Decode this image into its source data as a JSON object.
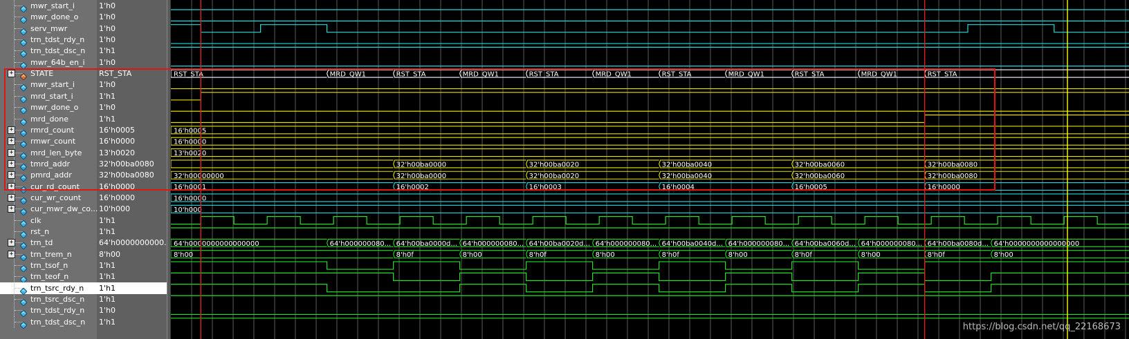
{
  "rows": [
    {
      "name": "mwr_start_i",
      "value": "1'h0",
      "icon": "wire-signal-icon",
      "expand": false,
      "color": "#23dcdc",
      "type": "bit",
      "steps": [
        [
          0,
          0
        ]
      ]
    },
    {
      "name": "mwr_done_o",
      "value": "1'h0",
      "icon": "wire-signal-icon",
      "expand": false,
      "color": "#23dcdc",
      "type": "bit",
      "steps": [
        [
          0,
          0
        ]
      ]
    },
    {
      "name": "serv_mwr",
      "value": "1'h0",
      "icon": "wire-signal-icon",
      "expand": false,
      "color": "#23dcdc",
      "type": "bit",
      "steps": [
        [
          0,
          1
        ],
        [
          9,
          0
        ],
        [
          27,
          1
        ],
        [
          47,
          0
        ],
        [
          240,
          1
        ],
        [
          266,
          0
        ]
      ]
    },
    {
      "name": "trn_tdst_rdy_n",
      "value": "1'h0",
      "icon": "wire-signal-icon",
      "expand": false,
      "color": "#23dcdc",
      "type": "bit",
      "steps": [
        [
          0,
          0
        ]
      ]
    },
    {
      "name": "trn_tdst_dsc_n",
      "value": "1'h1",
      "icon": "wire-signal-icon",
      "expand": false,
      "color": "#23dcdc",
      "type": "bit",
      "steps": [
        [
          0,
          1
        ]
      ]
    },
    {
      "name": "mwr_64b_en_i",
      "value": "1'h0",
      "icon": "wire-signal-icon",
      "expand": false,
      "color": "#23dcdc",
      "type": "bit",
      "steps": [
        [
          0,
          0
        ]
      ]
    },
    {
      "name": "STATE",
      "value": "RST_STA",
      "icon": "state-signal-icon",
      "expand": true,
      "color": "#ffffff",
      "type": "bus",
      "segs": [
        [
          0,
          "RST_STA"
        ],
        [
          47,
          "MRD_QW1"
        ],
        [
          67,
          "RST_STA"
        ],
        [
          87,
          "MRD_QW1"
        ],
        [
          107,
          "RST_STA"
        ],
        [
          127,
          "MRD_QW1"
        ],
        [
          147,
          "RST_STA"
        ],
        [
          167,
          "MRD_QW1"
        ],
        [
          187,
          "RST_STA"
        ],
        [
          207,
          "MRD_QW1"
        ],
        [
          227,
          "RST_STA"
        ]
      ]
    },
    {
      "name": "mwr_start_i",
      "value": "1'h0",
      "icon": "wire-signal-icon",
      "expand": false,
      "color": "#e8e000",
      "type": "bit",
      "steps": [
        [
          0,
          0
        ]
      ]
    },
    {
      "name": "mrd_start_i",
      "value": "1'h1",
      "icon": "wire-signal-icon",
      "expand": false,
      "color": "#e8e000",
      "type": "bit",
      "steps": [
        [
          0,
          0
        ],
        [
          9,
          1
        ]
      ]
    },
    {
      "name": "mwr_done_o",
      "value": "1'h0",
      "icon": "wire-signal-icon",
      "expand": false,
      "color": "#e8e000",
      "type": "bit",
      "steps": [
        [
          0,
          0
        ]
      ]
    },
    {
      "name": "mrd_done",
      "value": "1'h1",
      "icon": "wire-signal-icon",
      "expand": false,
      "color": "#e8e000",
      "type": "bit",
      "steps": [
        [
          0,
          0
        ],
        [
          227,
          1
        ]
      ]
    },
    {
      "name": "rmrd_count",
      "value": "16'h0005",
      "icon": "bus-signal-icon",
      "expand": true,
      "color": "#e8e000",
      "type": "bus",
      "segs": [
        [
          0,
          "16'h0005"
        ]
      ]
    },
    {
      "name": "rmwr_count",
      "value": "16'h0000",
      "icon": "bus-signal-icon",
      "expand": true,
      "color": "#e8e000",
      "type": "bus",
      "segs": [
        [
          0,
          "16'h0000"
        ]
      ]
    },
    {
      "name": "mrd_len_byte",
      "value": "13'h0020",
      "icon": "bus-signal-icon",
      "expand": true,
      "color": "#e8e000",
      "type": "bus",
      "segs": [
        [
          0,
          "13'h0020"
        ]
      ]
    },
    {
      "name": "tmrd_addr",
      "value": "32'h00ba0080",
      "icon": "bus-signal-icon",
      "expand": true,
      "color": "#e8e000",
      "type": "bus",
      "segs": [
        [
          0,
          ""
        ],
        [
          67,
          "32'h00ba0000"
        ],
        [
          107,
          "32'h00ba0020"
        ],
        [
          147,
          "32'h00ba0040"
        ],
        [
          187,
          "32'h00ba0060"
        ],
        [
          227,
          "32'h00ba0080"
        ]
      ]
    },
    {
      "name": "pmrd_addr",
      "value": "32'h00ba0080",
      "icon": "bus-signal-icon",
      "expand": true,
      "color": "#e8e000",
      "type": "bus",
      "segs": [
        [
          0,
          "32'h00000000"
        ],
        [
          67,
          "32'h00ba0000"
        ],
        [
          107,
          "32'h00ba0020"
        ],
        [
          147,
          "32'h00ba0040"
        ],
        [
          187,
          "32'h00ba0060"
        ],
        [
          227,
          "32'h00ba0080"
        ]
      ]
    },
    {
      "name": "cur_rd_count",
      "value": "16'h0000",
      "icon": "bus-signal-icon",
      "expand": true,
      "color": "#23dcdc",
      "type": "bus",
      "segs": [
        [
          0,
          "16'h0001"
        ],
        [
          67,
          "16'h0002"
        ],
        [
          107,
          "16'h0003"
        ],
        [
          147,
          "16'h0004"
        ],
        [
          187,
          "16'h0005"
        ],
        [
          227,
          "16'h0000"
        ]
      ]
    },
    {
      "name": "cur_wr_count",
      "value": "16'h0000",
      "icon": "bus-signal-icon",
      "expand": true,
      "color": "#23dcdc",
      "type": "bus",
      "segs": [
        [
          0,
          "16'h0000"
        ]
      ]
    },
    {
      "name": "cur_mwr_dw_co...",
      "value": "10'h000",
      "icon": "bus-signal-icon",
      "expand": true,
      "color": "#23dcdc",
      "type": "bus",
      "segs": [
        [
          0,
          "10'h000"
        ]
      ]
    },
    {
      "name": "clk",
      "value": "1'h1",
      "icon": "wire-signal-icon",
      "expand": false,
      "color": "#22e022",
      "type": "clk",
      "half": 10,
      "start": 0,
      "first": 9
    },
    {
      "name": "rst_n",
      "value": "1'h1",
      "icon": "wire-signal-icon",
      "expand": false,
      "color": "#22e022",
      "type": "bit",
      "steps": [
        [
          0,
          1
        ]
      ]
    },
    {
      "name": "trn_td",
      "value": "64'h0000000000...",
      "icon": "bus-signal-icon",
      "expand": true,
      "color": "#22e022",
      "type": "bus",
      "segs": [
        [
          0,
          "64'h0000000000000000"
        ],
        [
          47,
          "64'h000000080..."
        ],
        [
          67,
          "64'h00ba0000d..."
        ],
        [
          87,
          "64'h000000080..."
        ],
        [
          107,
          "64'h00ba0020d..."
        ],
        [
          127,
          "64'h000000080..."
        ],
        [
          147,
          "64'h00ba0040d..."
        ],
        [
          167,
          "64'h000000080..."
        ],
        [
          187,
          "64'h00ba0060d..."
        ],
        [
          207,
          "64'h000000080..."
        ],
        [
          227,
          "64'h00ba0080d..."
        ],
        [
          247,
          "64'h0000000000000000"
        ]
      ]
    },
    {
      "name": "trn_trem_n",
      "value": "8'h00",
      "icon": "bus-signal-icon",
      "expand": true,
      "color": "#22e022",
      "type": "bus",
      "segs": [
        [
          0,
          "8'h00"
        ],
        [
          67,
          "8'h0f"
        ],
        [
          87,
          "8'h00"
        ],
        [
          107,
          "8'h0f"
        ],
        [
          127,
          "8'h00"
        ],
        [
          147,
          "8'h0f"
        ],
        [
          167,
          "8'h00"
        ],
        [
          187,
          "8'h0f"
        ],
        [
          207,
          "8'h00"
        ],
        [
          227,
          "8'h0f"
        ],
        [
          247,
          "8'h00"
        ]
      ]
    },
    {
      "name": "trn_tsof_n",
      "value": "1'h1",
      "icon": "wire-signal-icon",
      "expand": false,
      "color": "#22e022",
      "type": "bit",
      "steps": [
        [
          0,
          1
        ],
        [
          47,
          0
        ],
        [
          67,
          1
        ],
        [
          87,
          0
        ],
        [
          107,
          1
        ],
        [
          127,
          0
        ],
        [
          147,
          1
        ],
        [
          167,
          0
        ],
        [
          187,
          1
        ],
        [
          207,
          0
        ],
        [
          227,
          1
        ]
      ]
    },
    {
      "name": "trn_teof_n",
      "value": "1'h1",
      "icon": "wire-signal-icon",
      "expand": false,
      "color": "#22e022",
      "type": "bit",
      "steps": [
        [
          0,
          1
        ],
        [
          67,
          0
        ],
        [
          87,
          1
        ],
        [
          107,
          0
        ],
        [
          127,
          1
        ],
        [
          147,
          0
        ],
        [
          167,
          1
        ],
        [
          187,
          0
        ],
        [
          207,
          1
        ],
        [
          227,
          0
        ],
        [
          247,
          1
        ]
      ]
    },
    {
      "name": "trn_tsrc_rdy_n",
      "value": "1'h1",
      "icon": "wire-signal-icon",
      "expand": false,
      "color": "#22e022",
      "type": "bit",
      "selected": true,
      "steps": [
        [
          0,
          1
        ],
        [
          47,
          0
        ],
        [
          87,
          1
        ],
        [
          107,
          0
        ],
        [
          127,
          1
        ],
        [
          147,
          0
        ],
        [
          167,
          1
        ],
        [
          187,
          0
        ],
        [
          207,
          1
        ],
        [
          227,
          0
        ],
        [
          247,
          1
        ]
      ]
    },
    {
      "name": "trn_tsrc_dsc_n",
      "value": "1'h1",
      "icon": "wire-signal-icon",
      "expand": false,
      "color": "#22e022",
      "type": "bit",
      "steps": [
        [
          0,
          1
        ]
      ]
    },
    {
      "name": "trn_tdst_rdy_n",
      "value": "1'h0",
      "icon": "wire-signal-icon",
      "expand": false,
      "color": "#22e022",
      "type": "bit",
      "steps": [
        [
          0,
          0
        ]
      ]
    },
    {
      "name": "trn_tdst_dsc_n",
      "value": "1'h1",
      "icon": "wire-signal-icon",
      "expand": false,
      "color": "#22e022",
      "type": "bit",
      "steps": [
        [
          0,
          1
        ]
      ]
    }
  ],
  "cursors": [
    {
      "name": "cursor-red-left",
      "time": 9,
      "color": "#e02020"
    },
    {
      "name": "cursor-red-right",
      "time": 227,
      "color": "#e02020"
    },
    {
      "name": "cursor-yellow",
      "time": 270,
      "color": "#ffff00"
    }
  ],
  "watermark": "https://blog.csdn.net/qq_22168673",
  "colors": {
    "highlight_box": "#e01515",
    "grid": "#5a5a5a",
    "selected_row": "#ffffff"
  }
}
